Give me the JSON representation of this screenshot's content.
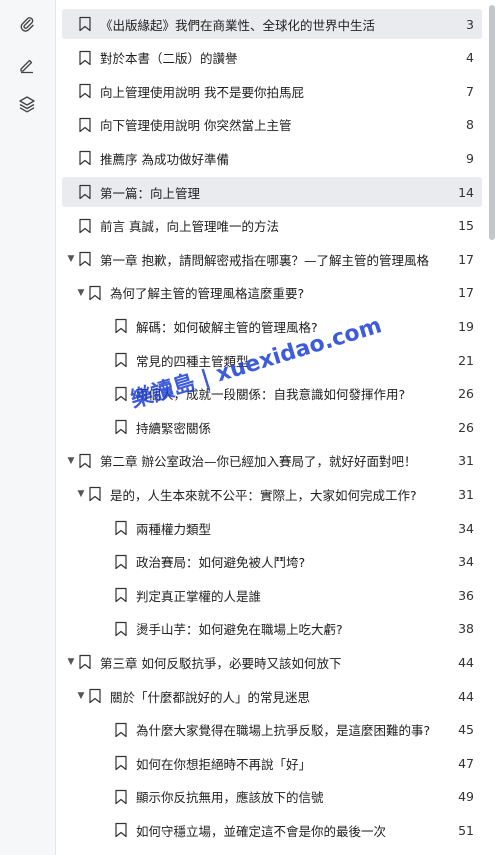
{
  "sidebar": {
    "icons": [
      "paperclip-icon",
      "pencil-icon",
      "layers-icon"
    ]
  },
  "toc": {
    "items": [
      {
        "title": "《出版緣起》我們在商業性、全球化的世界中生活",
        "page": "3",
        "level": 0,
        "arrow": "",
        "selected": true
      },
      {
        "title": "對於本書（二版）的讚譽",
        "page": "4",
        "level": 0,
        "arrow": ""
      },
      {
        "title": "向上管理使用說明 我不是要你拍馬屁",
        "page": "7",
        "level": 0,
        "arrow": ""
      },
      {
        "title": "向下管理使用說明 你突然當上主管",
        "page": "8",
        "level": 0,
        "arrow": ""
      },
      {
        "title": "推薦序 為成功做好準備",
        "page": "9",
        "level": 0,
        "arrow": ""
      },
      {
        "title": "第一篇：向上管理",
        "page": "14",
        "level": 0,
        "arrow": "",
        "selected": true
      },
      {
        "title": "前言 真誠，向上管理唯一的方法",
        "page": "15",
        "level": 0,
        "arrow": ""
      },
      {
        "title": "第一章 抱歉，請問解密戒指在哪裏？—了解主管的管理風格",
        "page": "17",
        "level": 0,
        "arrow": "▼"
      },
      {
        "title": "為何了解主管的管理風格這麼重要?",
        "page": "17",
        "level": 1,
        "arrow": "▼"
      },
      {
        "title": "解碼：如何破解主管的管理風格?",
        "page": "19",
        "level": 2,
        "arrow": ""
      },
      {
        "title": "常見的四種主管類型",
        "page": "21",
        "level": 2,
        "arrow": ""
      },
      {
        "title": "兩個人，成就一段關係：自我意識如何發揮作用?",
        "page": "26",
        "level": 2,
        "arrow": ""
      },
      {
        "title": "持續緊密關係",
        "page": "26",
        "level": 2,
        "arrow": ""
      },
      {
        "title": "第二章 辦公室政治—你已經加入賽局了，就好好面對吧！",
        "page": "31",
        "level": 0,
        "arrow": "▼"
      },
      {
        "title": "是的，人生本來就不公平：實際上，大家如何完成工作?",
        "page": "31",
        "level": 1,
        "arrow": "▼"
      },
      {
        "title": "兩種權力類型",
        "page": "34",
        "level": 2,
        "arrow": ""
      },
      {
        "title": "政治賽局：如何避免被人鬥垮?",
        "page": "34",
        "level": 2,
        "arrow": ""
      },
      {
        "title": "判定真正掌權的人是誰",
        "page": "36",
        "level": 2,
        "arrow": ""
      },
      {
        "title": "燙手山芋：如何避免在職場上吃大虧?",
        "page": "38",
        "level": 2,
        "arrow": ""
      },
      {
        "title": "第三章 如何反駁抗爭，必要時又該如何放下",
        "page": "44",
        "level": 0,
        "arrow": "▼"
      },
      {
        "title": "關於「什麼都說好的人」的常見迷思",
        "page": "44",
        "level": 1,
        "arrow": "▼"
      },
      {
        "title": "為什麼大家覺得在職場上抗爭反駁，是這麼困難的事?",
        "page": "45",
        "level": 2,
        "arrow": ""
      },
      {
        "title": "如何在你想拒絕時不再說「好」",
        "page": "47",
        "level": 2,
        "arrow": ""
      },
      {
        "title": "顯示你反抗無用，應該放下的信號",
        "page": "49",
        "level": 2,
        "arrow": ""
      },
      {
        "title": "如何守穩立場，並確定這不會是你的最後一次",
        "page": "51",
        "level": 2,
        "arrow": ""
      }
    ]
  },
  "watermark": "樂讀島 | xuexidao.com"
}
